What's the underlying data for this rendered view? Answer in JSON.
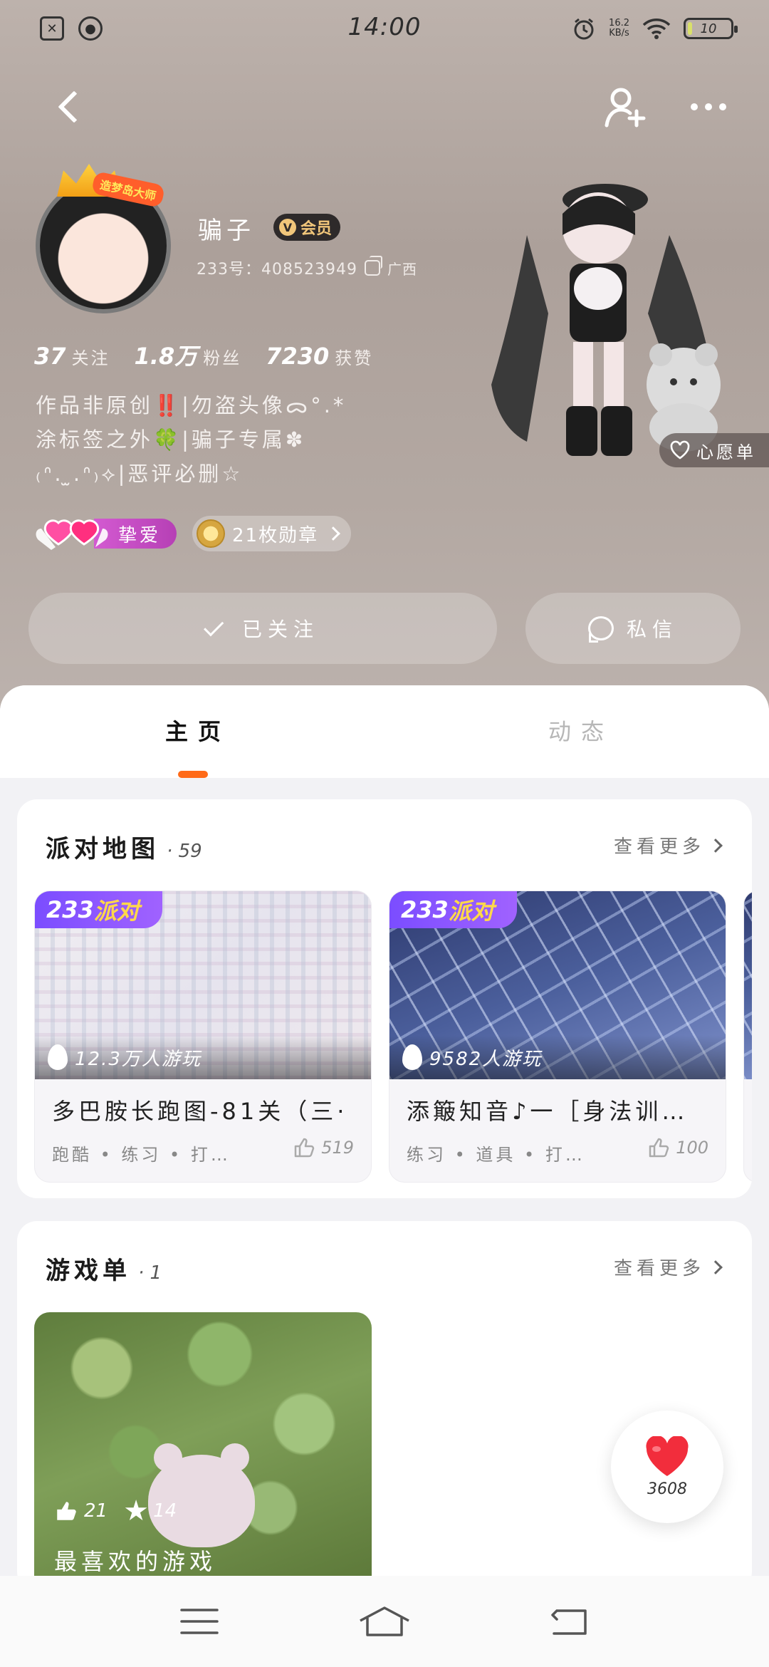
{
  "status_bar": {
    "time": "14:00",
    "net_speed": "16.2\nKB/s",
    "battery": "10",
    "icons": [
      "sim-off-icon",
      "app-icon",
      "alarm-icon",
      "wifi-icon",
      "battery-icon"
    ]
  },
  "profile": {
    "name": "骗子",
    "vip_label": "会员",
    "uid": "233号：408523949",
    "region": "广西",
    "avatar_tag": "造梦岛大师",
    "stats": [
      {
        "value": "37",
        "label": "关注"
      },
      {
        "value": "1.8万",
        "label": "粉丝"
      },
      {
        "value": "7230",
        "label": "获赞"
      }
    ],
    "bio": "作品非原创‼️|勿盗头像ᯅ°.*\n涂标签之外🍀|骗子专属✽\n₍ᐢ. ̫.ᐢ₎⟡|恶评必删☆",
    "love_badge": "挚爱",
    "medal_badge": "21枚勋章",
    "wish_list": "心愿单"
  },
  "actions": {
    "follow": "已关注",
    "message": "私信"
  },
  "tabs": {
    "home": "主页",
    "feed": "动态"
  },
  "party_maps": {
    "title": "派对地图",
    "count": "· 59",
    "see_more": "查看更多",
    "tag_prefix": "233",
    "tag_suffix": "派对",
    "items": [
      {
        "players": "12.3万人游玩",
        "name": "多巴胺长跑图-81关（三·",
        "tags": "跑酷 • 练习 • 打…",
        "likes": "519"
      },
      {
        "players": "9582人游玩",
        "name": "添簸知音♪一［身法训…",
        "tags": "练习 • 道具 • 打…",
        "likes": "100"
      }
    ]
  },
  "game_lists": {
    "title": "游戏单",
    "count": "· 1",
    "see_more": "查看更多",
    "items": [
      {
        "likes": "21",
        "stars": "14",
        "name": "最喜欢的游戏"
      }
    ]
  },
  "floating_like": {
    "count": "3608"
  },
  "colors": {
    "accent_orange": "#ff6a18",
    "party_purple": "#7b4dff",
    "love_pink": "#d35ad1",
    "heart_red": "#f22d3c"
  }
}
